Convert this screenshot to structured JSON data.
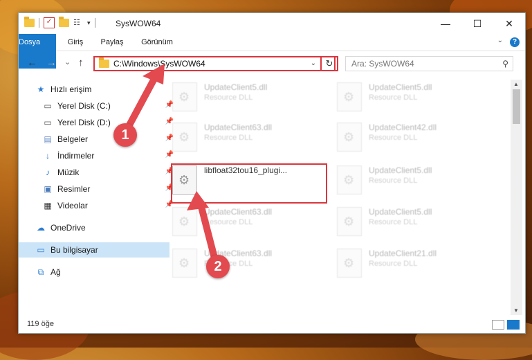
{
  "window": {
    "title": "SysWOW64",
    "minimize": "—",
    "maximize": "☐",
    "close": "✕"
  },
  "ribbon": {
    "tabs": [
      "Dosya",
      "Giriş",
      "Paylaş",
      "Görünüm"
    ],
    "help": "?"
  },
  "nav": {
    "back": "←",
    "forward": "→",
    "recent": "⌄",
    "up": "↑",
    "address": "C:\\Windows\\SysWOW64",
    "refresh": "↻",
    "search_placeholder": "Ara: SysWOW64"
  },
  "sidebar": {
    "items": [
      {
        "label": "Hızlı erişim",
        "icon": "star-icon"
      },
      {
        "label": "Yerel Disk (C:)",
        "icon": "drive-icon"
      },
      {
        "label": "Yerel Disk (D:)",
        "icon": "drive-icon"
      },
      {
        "label": "Belgeler",
        "icon": "documents-icon"
      },
      {
        "label": "İndirmeler",
        "icon": "download-icon"
      },
      {
        "label": "Müzik",
        "icon": "music-icon"
      },
      {
        "label": "Resimler",
        "icon": "pictures-icon"
      },
      {
        "label": "Videolar",
        "icon": "video-icon"
      },
      {
        "label": "OneDrive",
        "icon": "cloud-icon"
      },
      {
        "label": "Bu bilgisayar",
        "icon": "computer-icon"
      },
      {
        "label": "Ağ",
        "icon": "network-icon"
      }
    ]
  },
  "files": [
    {
      "name": "UpdateClient5.dll",
      "desc": "Resource DLL"
    },
    {
      "name": "UpdateClient5.dll",
      "desc": "Resource DLL"
    },
    {
      "name": "UpdateClient63.dll",
      "desc": "Resource DLL"
    },
    {
      "name": "UpdateClient42.dll",
      "desc": "Resource DLL"
    },
    {
      "name": "libfloat32tou16_plugi...",
      "desc": ""
    },
    {
      "name": "UpdateClient5.dll",
      "desc": "Resource DLL"
    },
    {
      "name": "UpdateClient63.dll",
      "desc": "Resource DLL"
    },
    {
      "name": "UpdateClient5.dll",
      "desc": "Resource DLL"
    },
    {
      "name": "UpdateClient63.dll",
      "desc": "Resource DLL"
    },
    {
      "name": "UpdateClient21.dll",
      "desc": "Resource DLL"
    }
  ],
  "status": {
    "count": "119 öğe"
  },
  "annotations": {
    "badge1": "1",
    "badge2": "2"
  },
  "colors": {
    "accent": "#1979ca",
    "highlight": "#d9363e",
    "badge": "#e24a4f"
  }
}
